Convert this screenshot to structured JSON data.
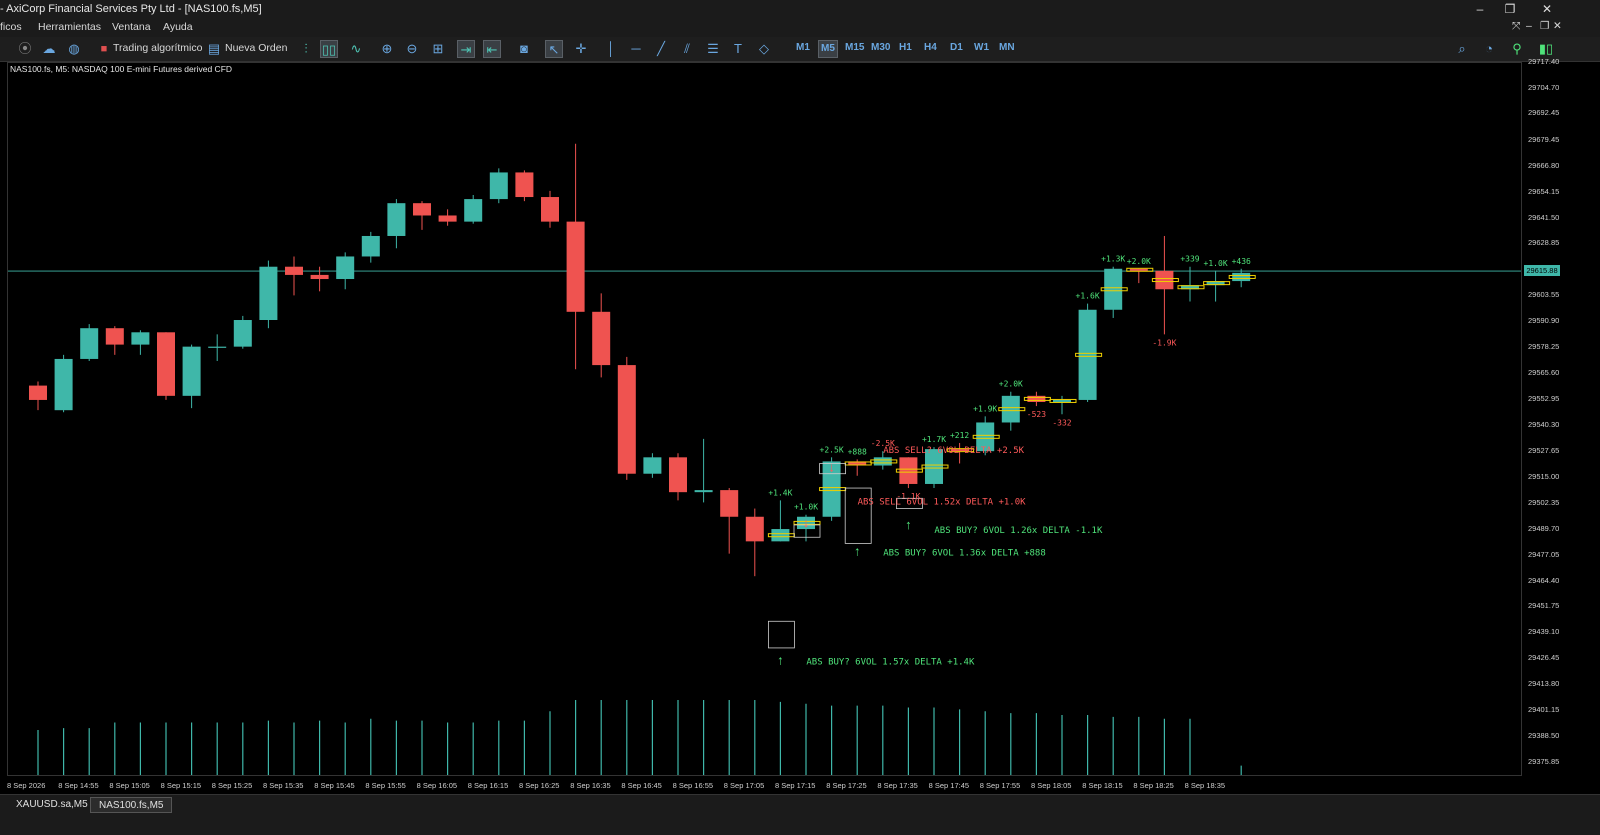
{
  "window": {
    "title": "- AxiCorp Financial Services Pty Ltd - [NAS100.fs,M5]"
  },
  "menu": [
    "ficos",
    "Herramientas",
    "Ventana",
    "Ayuda"
  ],
  "toolbar": {
    "algo_label": "Trading algorítmico",
    "order_label": "Nueva Orden",
    "timeframes": [
      "M1",
      "M5",
      "M15",
      "M30",
      "H1",
      "H4",
      "D1",
      "W1",
      "MN"
    ],
    "active_timeframe": "M5"
  },
  "chart": {
    "symbol_label": "NAS100.fs, M5:  NASDAQ 100 E-mini Futures derived CFD",
    "current_price": "29615.88",
    "bull_color": "#3fb7a9",
    "bear_color": "#ef5350",
    "y_ticks": [
      "29717.40",
      "29704.70",
      "29692.45",
      "29679.45",
      "29666.80",
      "29654.15",
      "29641.50",
      "29628.85",
      "29615.88",
      "29603.55",
      "29590.90",
      "29578.25",
      "29565.60",
      "29552.95",
      "29540.30",
      "29527.65",
      "29515.00",
      "29502.35",
      "29489.70",
      "29477.05",
      "29464.40",
      "29451.75",
      "29439.10",
      "29426.45",
      "29413.80",
      "29401.15",
      "29388.50",
      "29375.85"
    ],
    "x_ticks": [
      "8 Sep 2026",
      "8 Sep 14:55",
      "8 Sep 15:05",
      "8 Sep 15:15",
      "8 Sep 15:25",
      "8 Sep 15:35",
      "8 Sep 15:45",
      "8 Sep 15:55",
      "8 Sep 16:05",
      "8 Sep 16:15",
      "8 Sep 16:25",
      "8 Sep 16:35",
      "8 Sep 16:45",
      "8 Sep 16:55",
      "8 Sep 17:05",
      "8 Sep 17:15",
      "8 Sep 17:25",
      "8 Sep 17:35",
      "8 Sep 17:45",
      "8 Sep 17:55",
      "8 Sep 18:05",
      "8 Sep 18:15",
      "8 Sep 18:25",
      "8 Sep 18:35"
    ],
    "candles": [
      {
        "o": 29560,
        "h": 29562,
        "l": 29548,
        "c": 29553
      },
      {
        "o": 29548,
        "h": 29575,
        "l": 29547,
        "c": 29573
      },
      {
        "o": 29573,
        "h": 29590,
        "l": 29572,
        "c": 29588
      },
      {
        "o": 29588,
        "h": 29589,
        "l": 29575,
        "c": 29580
      },
      {
        "o": 29580,
        "h": 29587,
        "l": 29575,
        "c": 29586
      },
      {
        "o": 29586,
        "h": 29586,
        "l": 29553,
        "c": 29555
      },
      {
        "o": 29555,
        "h": 29580,
        "l": 29549,
        "c": 29579
      },
      {
        "o": 29579,
        "h": 29585,
        "l": 29572,
        "c": 29579
      },
      {
        "o": 29579,
        "h": 29594,
        "l": 29578,
        "c": 29592
      },
      {
        "o": 29592,
        "h": 29621,
        "l": 29588,
        "c": 29618
      },
      {
        "o": 29618,
        "h": 29623,
        "l": 29604,
        "c": 29614
      },
      {
        "o": 29614,
        "h": 29618,
        "l": 29606,
        "c": 29612
      },
      {
        "o": 29612,
        "h": 29625,
        "l": 29607,
        "c": 29623
      },
      {
        "o": 29623,
        "h": 29635,
        "l": 29620,
        "c": 29633
      },
      {
        "o": 29633,
        "h": 29651,
        "l": 29627,
        "c": 29649
      },
      {
        "o": 29649,
        "h": 29650,
        "l": 29636,
        "c": 29643
      },
      {
        "o": 29643,
        "h": 29646,
        "l": 29638,
        "c": 29640
      },
      {
        "o": 29640,
        "h": 29653,
        "l": 29639,
        "c": 29651
      },
      {
        "o": 29651,
        "h": 29666,
        "l": 29649,
        "c": 29664
      },
      {
        "o": 29664,
        "h": 29665,
        "l": 29650,
        "c": 29652
      },
      {
        "o": 29652,
        "h": 29655,
        "l": 29637,
        "c": 29640
      },
      {
        "o": 29640,
        "h": 29678,
        "l": 29568,
        "c": 29596
      },
      {
        "o": 29596,
        "h": 29605,
        "l": 29564,
        "c": 29570
      },
      {
        "o": 29570,
        "h": 29574,
        "l": 29514,
        "c": 29517
      },
      {
        "o": 29517,
        "h": 29527,
        "l": 29515,
        "c": 29525
      },
      {
        "o": 29525,
        "h": 29527,
        "l": 29504,
        "c": 29508
      },
      {
        "o": 29508,
        "h": 29534,
        "l": 29503,
        "c": 29509
      },
      {
        "o": 29509,
        "h": 29510,
        "l": 29478,
        "c": 29496
      },
      {
        "o": 29496,
        "h": 29500,
        "l": 29467,
        "c": 29484
      },
      {
        "o": 29484,
        "h": 29504,
        "l": 29484,
        "c": 29490
      },
      {
        "o": 29490,
        "h": 29497,
        "l": 29484,
        "c": 29496
      },
      {
        "o": 29496,
        "h": 29525,
        "l": 29494,
        "c": 29523
      },
      {
        "o": 29523,
        "h": 29524,
        "l": 29516,
        "c": 29521
      },
      {
        "o": 29521,
        "h": 29528,
        "l": 29519,
        "c": 29525
      },
      {
        "o": 29525,
        "h": 29525,
        "l": 29510,
        "c": 29512
      },
      {
        "o": 29512,
        "h": 29530,
        "l": 29510,
        "c": 29529
      },
      {
        "o": 29529,
        "h": 29532,
        "l": 29522,
        "c": 29528
      },
      {
        "o": 29528,
        "h": 29545,
        "l": 29526,
        "c": 29542
      },
      {
        "o": 29542,
        "h": 29557,
        "l": 29538,
        "c": 29555
      },
      {
        "o": 29555,
        "h": 29557,
        "l": 29550,
        "c": 29552
      },
      {
        "o": 29552,
        "h": 29555,
        "l": 29546,
        "c": 29553
      },
      {
        "o": 29553,
        "h": 29600,
        "l": 29552,
        "c": 29597
      },
      {
        "o": 29597,
        "h": 29618,
        "l": 29593,
        "c": 29617
      },
      {
        "o": 29617,
        "h": 29617,
        "l": 29610,
        "c": 29616
      },
      {
        "o": 29616,
        "h": 29633,
        "l": 29585,
        "c": 29607
      },
      {
        "o": 29607,
        "h": 29618,
        "l": 29601,
        "c": 29609
      },
      {
        "o": 29609,
        "h": 29616,
        "l": 29601,
        "c": 29611
      },
      {
        "o": 29611,
        "h": 29617,
        "l": 29608,
        "c": 29615
      }
    ],
    "volumes": [
      0.24,
      0.25,
      0.25,
      0.28,
      0.28,
      0.28,
      0.28,
      0.28,
      0.28,
      0.29,
      0.28,
      0.29,
      0.28,
      0.3,
      0.29,
      0.29,
      0.28,
      0.28,
      0.29,
      0.29,
      0.34,
      0.4,
      0.4,
      0.4,
      0.4,
      0.4,
      0.4,
      0.4,
      0.4,
      0.39,
      0.38,
      0.37,
      0.37,
      0.37,
      0.36,
      0.36,
      0.35,
      0.34,
      0.33,
      0.33,
      0.32,
      0.32,
      0.31,
      0.31,
      0.3,
      0.3,
      0.0,
      0.05
    ],
    "deltas": [
      {
        "idx": 29,
        "text": "+1.4K",
        "pos": "above",
        "sign": "pos"
      },
      {
        "idx": 30,
        "text": "+1.0K",
        "pos": "above",
        "sign": "pos"
      },
      {
        "idx": 31,
        "text": "+2.5K",
        "pos": "above",
        "sign": "pos"
      },
      {
        "idx": 32,
        "text": "+888",
        "pos": "above",
        "sign": "pos"
      },
      {
        "idx": 33,
        "text": "-2.5K",
        "pos": "above",
        "sign": "neg"
      },
      {
        "idx": 34,
        "text": "-1.1K",
        "pos": "below",
        "sign": "neg"
      },
      {
        "idx": 35,
        "text": "+1.7K",
        "pos": "above",
        "sign": "pos"
      },
      {
        "idx": 36,
        "text": "+212",
        "pos": "above",
        "sign": "pos"
      },
      {
        "idx": 37,
        "text": "+1.9K",
        "pos": "above",
        "sign": "pos"
      },
      {
        "idx": 38,
        "text": "+2.0K",
        "pos": "above",
        "sign": "pos"
      },
      {
        "idx": 39,
        "text": "-523",
        "pos": "below",
        "sign": "neg"
      },
      {
        "idx": 40,
        "text": "-332",
        "pos": "below",
        "sign": "neg"
      },
      {
        "idx": 41,
        "text": "+1.6K",
        "pos": "above",
        "sign": "pos"
      },
      {
        "idx": 42,
        "text": "+1.3K",
        "pos": "above",
        "sign": "pos"
      },
      {
        "idx": 43,
        "text": "+2.0K",
        "pos": "above",
        "sign": "pos"
      },
      {
        "idx": 44,
        "text": "-1.9K",
        "pos": "below",
        "sign": "neg"
      },
      {
        "idx": 45,
        "text": "+339",
        "pos": "above",
        "sign": "pos"
      },
      {
        "idx": 46,
        "text": "+1.0K",
        "pos": "above",
        "sign": "pos"
      },
      {
        "idx": 47,
        "text": "+436",
        "pos": "above",
        "sign": "pos"
      }
    ],
    "signals": [
      {
        "text": "ABS BUY? 6VOL 1.57x  DELTA +1.4K",
        "sign": "pos"
      },
      {
        "text": "ABS BUY? 6VOL 1.36x  DELTA +888",
        "sign": "pos"
      },
      {
        "text": "ABS BUY? 6VOL 1.26x  DELTA -1.1K",
        "sign": "pos"
      },
      {
        "text": "ABS SELL 6VOL 1.52x  DELTA +1.0K",
        "sign": "neg"
      },
      {
        "text": "ABS SELL? 6VOL      DELTA +2.5K",
        "sign": "neg"
      }
    ]
  },
  "tabs": [
    {
      "label": "XAUUSD.sa,M5",
      "active": false
    },
    {
      "label": "NAS100.fs,M5",
      "active": true
    }
  ]
}
